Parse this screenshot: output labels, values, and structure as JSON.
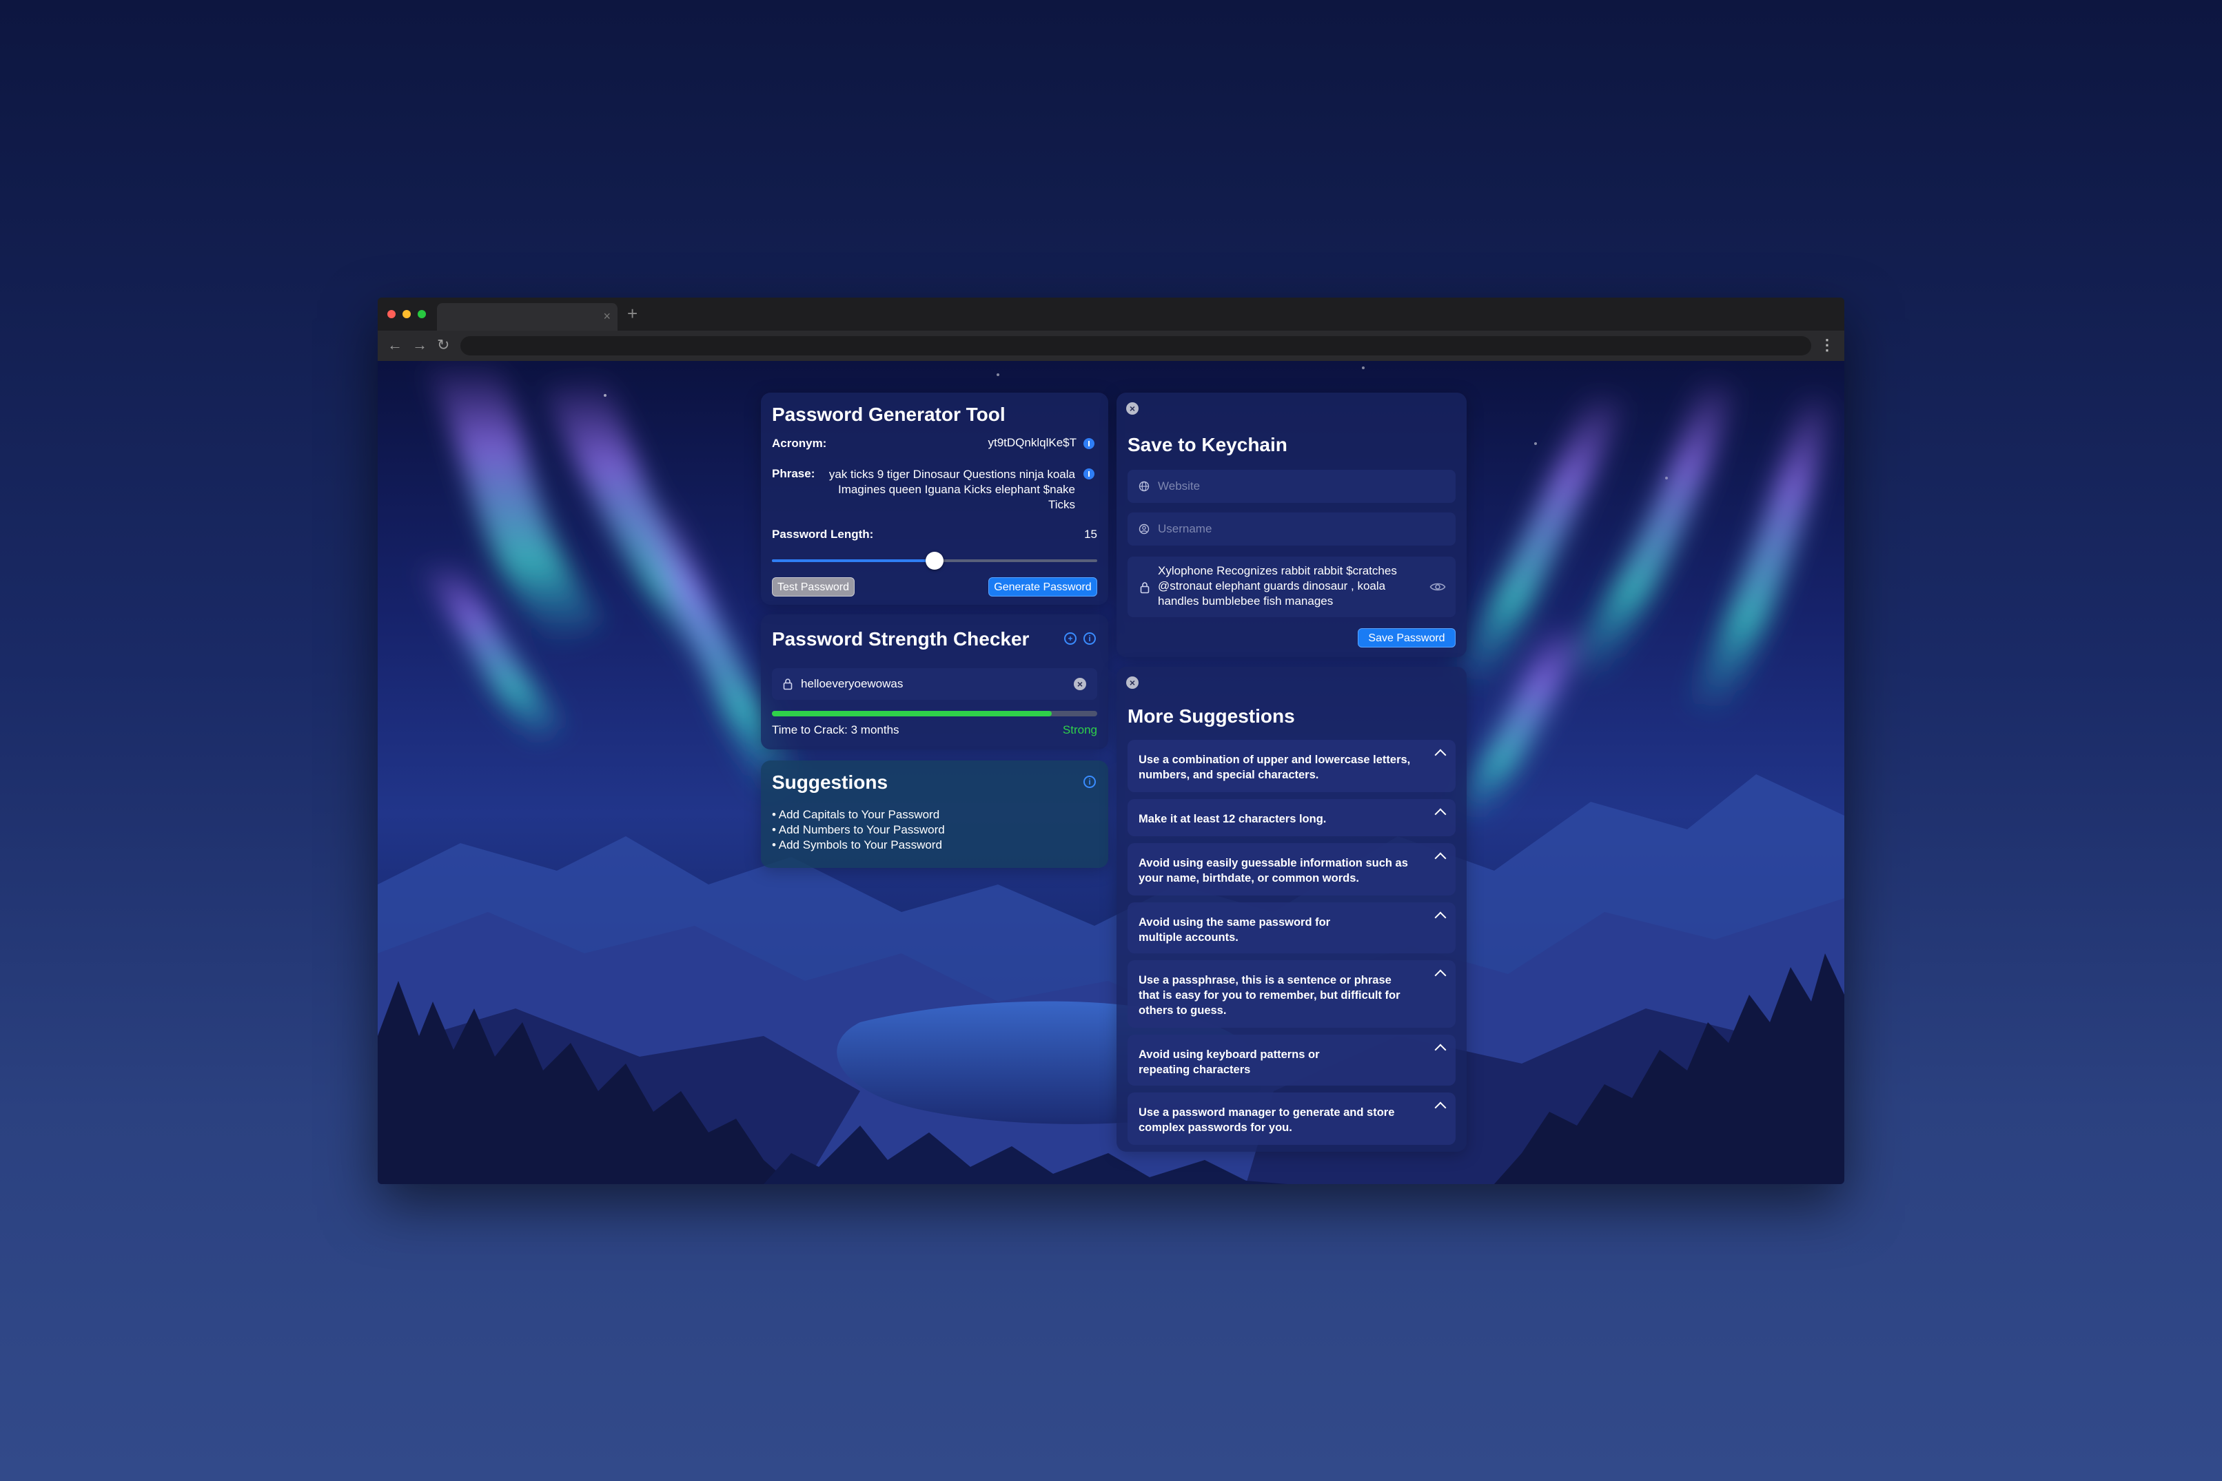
{
  "browser": {
    "tab_close": "×",
    "new_tab": "+",
    "back": "←",
    "forward": "→",
    "reload": "↻",
    "menu": "⋮"
  },
  "generator": {
    "title": "Password Generator Tool",
    "acronym_label": "Acronym:",
    "acronym_value": "yt9tDQnklqlKe$T",
    "phrase_label": "Phrase:",
    "phrase_value": "yak ticks 9 tiger Dinosaur Questions ninja koala Imagines queen Iguana Kicks elephant $nake Ticks",
    "length_label": "Password Length:",
    "length_value": "15",
    "slider_fraction": 0.5,
    "test_button": "Test Password",
    "generate_button": "Generate Password"
  },
  "strength": {
    "title": "Password Strength Checker",
    "password_value": "helloeveryoewowas",
    "meter_fraction": 0.86,
    "time_to_crack": "Time to Crack: 3 months",
    "rating": "Strong",
    "rating_color": "#2fd14a"
  },
  "suggestions": {
    "title": "Suggestions",
    "items": [
      "• Add Capitals to Your Password",
      "• Add Numbers to Your Password",
      "• Add Symbols to Your Password"
    ]
  },
  "keychain": {
    "title": "Save to Keychain",
    "website_placeholder": "Website",
    "username_placeholder": "Username",
    "password_value": "Xylophone Recognizes rabbit rabbit $cratches @stronaut elephant guards dinosaur ,  koala handles bumblebee fish manages",
    "save_button": "Save Password"
  },
  "more_suggestions": {
    "title": "More Suggestions",
    "items": [
      "Use a combination of upper and lowercase letters, numbers, and special characters.",
      "Make it at least 12 characters long.",
      "Avoid using easily guessable information such as your name, birthdate, or common words.",
      "Avoid using the same password for multiple accounts.",
      "Use a passphrase, this is a sentence or phrase that is easy for you to remember, but difficult for others to guess.",
      "Avoid using keyboard patterns or repeating characters",
      "Use a password manager to generate and store complex passwords for you."
    ]
  },
  "colors": {
    "accent": "#1a7cf4",
    "strong": "#2fd14a"
  }
}
